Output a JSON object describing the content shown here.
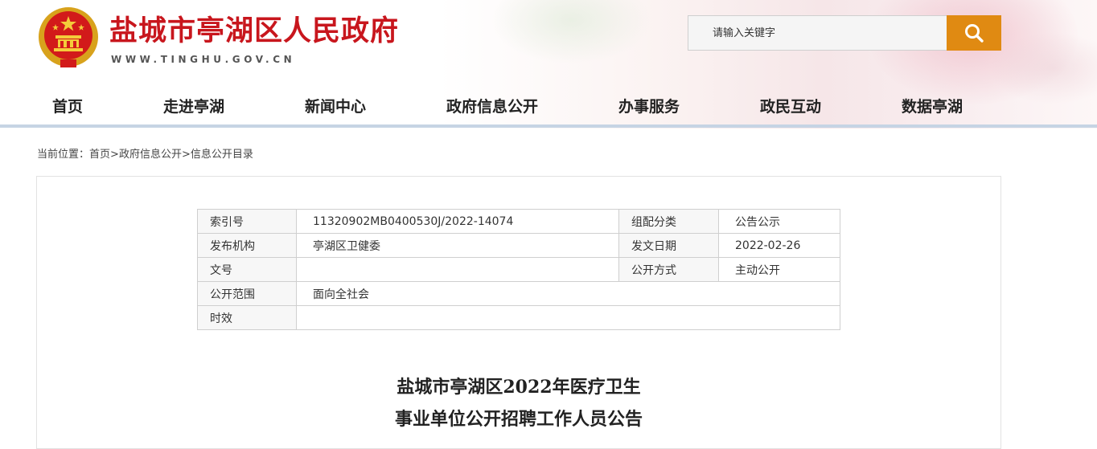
{
  "header": {
    "site_title": "盐城市亭湖区人民政府",
    "site_url": "WWW.TINGHU.GOV.CN",
    "emblem_icon": "national-emblem-icon"
  },
  "search": {
    "placeholder": "请输入关键字",
    "button_icon": "search-icon",
    "button_color": "#e08a12"
  },
  "nav": {
    "items": [
      {
        "label": "首页"
      },
      {
        "label": "走进亭湖"
      },
      {
        "label": "新闻中心"
      },
      {
        "label": "政府信息公开"
      },
      {
        "label": "办事服务"
      },
      {
        "label": "政民互动"
      },
      {
        "label": "数据亭湖"
      }
    ]
  },
  "breadcrumb": {
    "prefix": "当前位置：",
    "items": [
      "首页",
      "政府信息公开",
      "信息公开目录"
    ],
    "separator": ">"
  },
  "meta_table": {
    "rows": [
      {
        "l1": "索引号",
        "v1": "11320902MB0400530J/2022-14074",
        "l2": "组配分类",
        "v2": "公告公示"
      },
      {
        "l1": "发布机构",
        "v1": "亭湖区卫健委",
        "l2": "发文日期",
        "v2": "2022-02-26"
      },
      {
        "l1": "文号",
        "v1": "",
        "l2": "公开方式",
        "v2": "主动公开"
      },
      {
        "l1": "公开范围",
        "v1": "面向全社会"
      },
      {
        "l1": "时效",
        "v1": ""
      }
    ]
  },
  "article": {
    "title_line1": "盐城市亭湖区2022年医疗卫生",
    "title_line2": "事业单位公开招聘工作人员公告"
  },
  "colors": {
    "brand_red": "#c8161d",
    "accent_orange": "#e08a12",
    "nav_rule": "#c6d4e4"
  }
}
